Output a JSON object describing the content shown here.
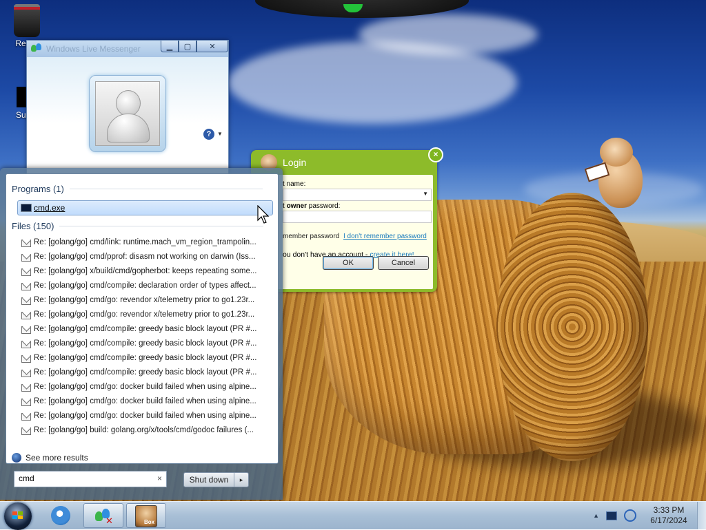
{
  "desktop": {
    "icons": [
      {
        "label": "Recyc",
        "icon": "recycle-bin-icon"
      },
      {
        "label": "Super",
        "icon": "app-icon"
      }
    ]
  },
  "messenger": {
    "title": "Windows Live Messenger",
    "help_label": "?"
  },
  "login": {
    "title": "Login",
    "account_label_visible": "t name:",
    "password_label_prefix": "t ",
    "password_label_bold": "owner",
    "password_label_suffix": " password:",
    "remember_label": "member password",
    "forgot_link": "I don't remember password",
    "no_account_text": "ou don't have an account - ",
    "create_link": "create it here!",
    "ok_label": "OK",
    "cancel_label": "Cancel",
    "close_label": "×"
  },
  "start_menu": {
    "programs_header": "Programs (1)",
    "programs": [
      {
        "label": "cmd.exe",
        "icon": "cmd-icon"
      }
    ],
    "files_header": "Files (150)",
    "files": [
      "Re: [golang/go] cmd/link: runtime.mach_vm_region_trampolin...",
      "Re: [golang/go] cmd/pprof: disasm not working on darwin (Iss...",
      "Re: [golang/go] x/build/cmd/gopherbot: keeps repeating some...",
      "Re: [golang/go] cmd/compile: declaration order of types affect...",
      "Re: [golang/go] cmd/go: revendor x/telemetry prior to go1.23r...",
      "Re: [golang/go] cmd/go: revendor x/telemetry prior to go1.23r...",
      "Re: [golang/go] cmd/compile: greedy basic block layout (PR #...",
      "Re: [golang/go] cmd/compile: greedy basic block layout (PR #...",
      "Re: [golang/go] cmd/compile: greedy basic block layout (PR #...",
      "Re: [golang/go] cmd/compile: greedy basic block layout (PR #...",
      "Re: [golang/go] cmd/go: docker build failed when using alpine...",
      "Re: [golang/go] cmd/go: docker build failed when using alpine...",
      "Re: [golang/go] cmd/go: docker build failed when using alpine...",
      "Re: [golang/go] build: golang.org/x/tools/cmd/godoc failures (..."
    ],
    "see_more": "See more results",
    "search_value": "cmd",
    "clear_label": "×",
    "shutdown_label": "Shut down",
    "shutdown_arrow": "▸"
  },
  "taskbar": {
    "items": [
      {
        "name": "internet-explorer",
        "icon": "ie-icon",
        "active": false
      },
      {
        "name": "windows-live-messenger",
        "icon": "messenger-icon",
        "active": true
      },
      {
        "name": "box-app",
        "icon": "hamster-box-icon",
        "active": true,
        "badge": "Box"
      }
    ],
    "tray_arrow": "▲",
    "clock_time": "3:33 PM",
    "clock_date": "6/17/2024"
  }
}
